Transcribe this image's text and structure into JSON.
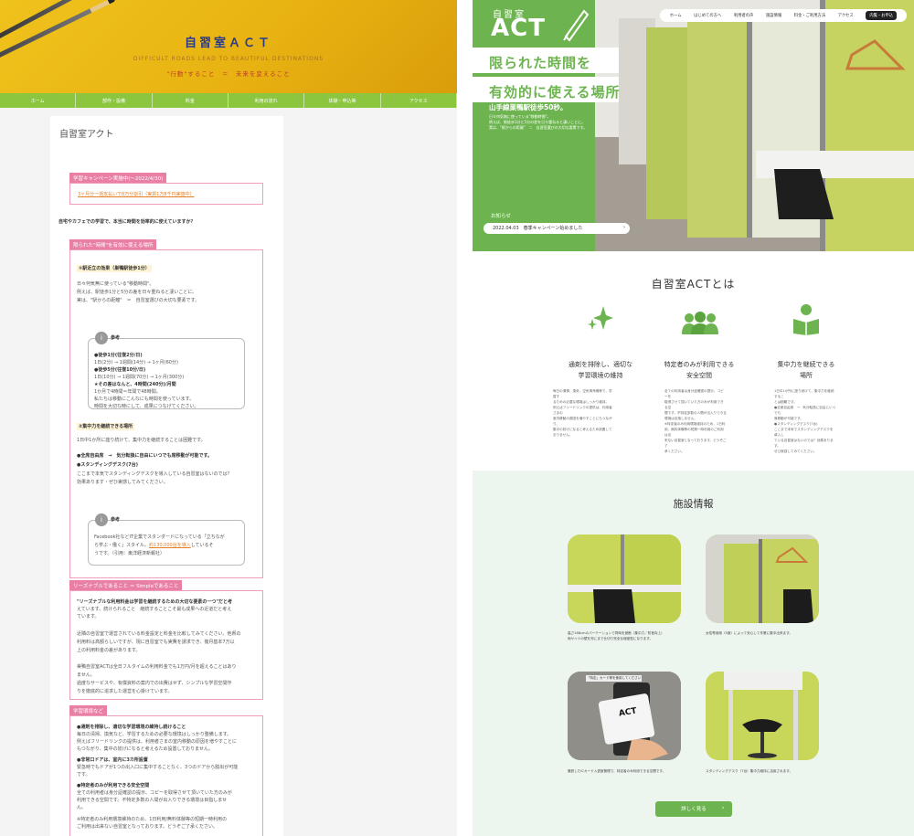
{
  "left_page": {
    "header": {
      "title": "自習室ＡＣＴ",
      "subtitle_en": "DIFFICULT ROADS LEAD TO BEAUTIFUL DESTINATIONS",
      "subtitle_jp": "\"行動\"すること　＝　未来を変えること"
    },
    "nav": [
      "ホーム",
      "部作・設備",
      "料金",
      "利用の流れ",
      "体験・申込等",
      "アクセス"
    ],
    "page_title": "自習室アクト",
    "campaign": {
      "tag": "学習キャンペーン実施中(〜2022/4/30)",
      "link": "3ヶ月分一括支払いで8万分割引（実質1万8千円実施中）"
    },
    "lead": "自宅やカフェでの学習で、本当に時間を効率的に使えていますか？",
    "section1": {
      "tag": "限られた\"時間\"を有効に使える場所",
      "h1": "①駅近立の効果（巣鴨駅徒歩1分）",
      "p1": [
        "日々何気無に使っている\"移動時間\"。",
        "例えば、駅徒歩1分と5分の差を日々重ねると凄いことに。",
        "実は、\"駅からの距離\"　＝　自習室選びの大切な要素です。"
      ],
      "ref_label": "参考",
      "ref_lines": [
        "●徒歩1分(往復2分/日)",
        "1日(2分) → 1週間(14分) → 1ヶ月(60分)",
        "●徒歩5分(往復10分/日)",
        "1日(10分) → 1週間(70分) → 1ヶ月(300分)",
        "★その差はなんと、4時間(240分)/月間",
        "1か月で4時間＝年間で48時間。",
        "私たちは移動にこんなにも時間を使っています。",
        "時間を大切な時にして、成果につなげてください。"
      ],
      "h2": "②集中力を継続できる場所",
      "p2": "1日中1か所に座り続けて、集中力を継続することは困難です。",
      "b1": "●全席自由席　→　気分転換に自由にいつでも席移動が可能です。",
      "b2": "●スタンディングデスク(7台)",
      "p3": [
        "ここまで本気でスタンディングデスクを導入している自習室はないのでは？",
        "効果あります・ぜひ実感してみてください。"
      ],
      "ref2_label": "参考",
      "ref2_lines": [
        "Facebook社などIT企業でスタンダードになっている「立ちなが",
        "ら学ぶ・働く」スタイル。",
        "約130,000台を導入",
        "しているそ",
        "うです。（引用：東洋経済新報社）"
      ]
    },
    "section2": {
      "tag": "リーズナブルであること ＝ Simpleであること",
      "lines": [
        "\"リーズナブルな利用料金は学習を継続するための大切な要素の一つ\"だと考",
        "えています。続けられること　継続することこそ最も成果への近道だと考え",
        "ています。",
        "",
        "近隣の自習室で運営されている料金設定と料金を比較してみてください。他県の",
        "利用料は高額らしいですが、現に自習室でも実費を請求でき、複月基本7万以",
        "上の利用料金の差があります。",
        "",
        "巣鴨自習室ACTは全日フルタイムの利用料金でも1万円/月を超えることはあり",
        "ません。",
        "過度なサービスや、有償資料の案内での出費はせず、シンプルな学習空間作",
        "りを徹底的に追求した運営を心掛けています。"
      ]
    },
    "section3": {
      "tag": "学習環境など",
      "lines": [
        "●通剤を排除し、適切な学習環境の維持し続けること",
        "毎日の清掃、換気など、学習するための必要な環境はしっかり整備します。",
        "例えばフリードリンクの提供は、利用者さまの室内移動の原因を増やすことに",
        "もつながり、集中の妨げになると考えるため設置しておりません。",
        "●非常口ドアは、室内に3カ所設置",
        "緊急時でもドアが1つの出入口に集中することなく、3つのドアから脱出が可能",
        "です。",
        "●特定者のみが利用できる安全空間",
        "全ての利用者は身分証確認の提示、コピーを取得させて頂いていた方のみが",
        "利用できる空間です。不特定多数の人間が出入りできる環境は目指しませ",
        "ん。",
        "※特定者のみ利用環境維持のため、1日利用/無料体験等の短期一時利用の",
        "ご利用は出来ない自習室となっております。どうぞご了承ください。"
      ]
    }
  },
  "right_page": {
    "logo_top": "自習室",
    "logo_main": "ACT",
    "nav": [
      "ホーム",
      "はじめての方へ",
      "利用者の声",
      "施設情報",
      "料金・ご利用方法",
      "アクセス"
    ],
    "nav_cta": "内覧・お申込",
    "hero": {
      "headline1": "限られた時間を",
      "headline2": "有効的に使える場所",
      "subhead": "山手線巣鴨駅徒歩50秒。",
      "small": [
        "日々何気無に使っている\"移動時間\"。",
        "例えば、駅徒歩1分と5分の差を日々重ねると凄いことに。",
        "実は、\"駅からの距離\"　＝　自習室選びの大切な要素です。"
      ],
      "notice_label": "お知らせ",
      "notice_date": "2022.04.03",
      "notice_text": "春季キャンペーン始めました"
    },
    "about": {
      "title": "自習室ACTとは",
      "features": [
        {
          "icon": "sparkle-icon",
          "title1": "通剤を排除し、適切な",
          "title2": "学習環境の維持",
          "desc": [
            "毎日の清掃、換気、空気清浄機等で、学習す",
            "るための必要な環境はしっかり維持。",
            "例えばフリードリンクの提供は、利用者さまの",
            "室内移動の原因を増やすことにもつながり、",
            "集中の妨げになると考えるため設置して",
            "おりません。"
          ]
        },
        {
          "icon": "group-icon",
          "title1": "特定者のみが利用できる",
          "title2": "安全空間",
          "desc": [
            "全ての利用者は身分証確認の提示、コピーを",
            "取得させて頂いていた方のみが利用できる空",
            "間です。不特定多数の人間が出入りできる",
            "環境は目指しません。",
            "※特定者のみ利用環境維持のため、1日利",
            "用、無料体験等の短期一時利用のご利用は出",
            "来ない自習室となっております。どうぞご了",
            "承ください。"
          ]
        },
        {
          "icon": "reader-icon",
          "title1": "集中力を継続できる",
          "title2": "場所",
          "desc": [
            "1日中1か所に座り続けて、集中力を継続するこ",
            "とは困難です。",
            "●全席自由席　→　気分転換に自由にいつでも",
            "席移動が可能です。",
            "●スタンディングデスク(7台)",
            "ここまで本気でスタンディングデスクを導入し",
            "ている自習室はないのでは？効果あります。",
            "ぜひ実感してみてください。"
          ]
        }
      ]
    },
    "facility": {
      "title": "施設情報",
      "captions": [
        [
          "高さ168cmのパーテーションで同時を遮断（集中力／防音向上）",
          "両サイドの壁を完にまで仕切り完全な個室型になります。"
        ],
        [
          "女性専用席（5席）によって安心して作業に集中出来ます。"
        ],
        [
          "徹底したICカード入退室管理で、特定者のみ利用できる空間です。"
        ],
        [
          "スタンディングデスク（7台）集中力維持に活用されます。"
        ]
      ],
      "card_text": "ACT",
      "card_label": "「特定」カード等を使用してください",
      "button": "詳しく見る"
    }
  },
  "colors": {
    "green": "#6db450",
    "nav_green": "#8cc63f",
    "pink": "#e97fa4",
    "yellow": "#f0c21c",
    "title_blue": "#2a3a8a"
  }
}
